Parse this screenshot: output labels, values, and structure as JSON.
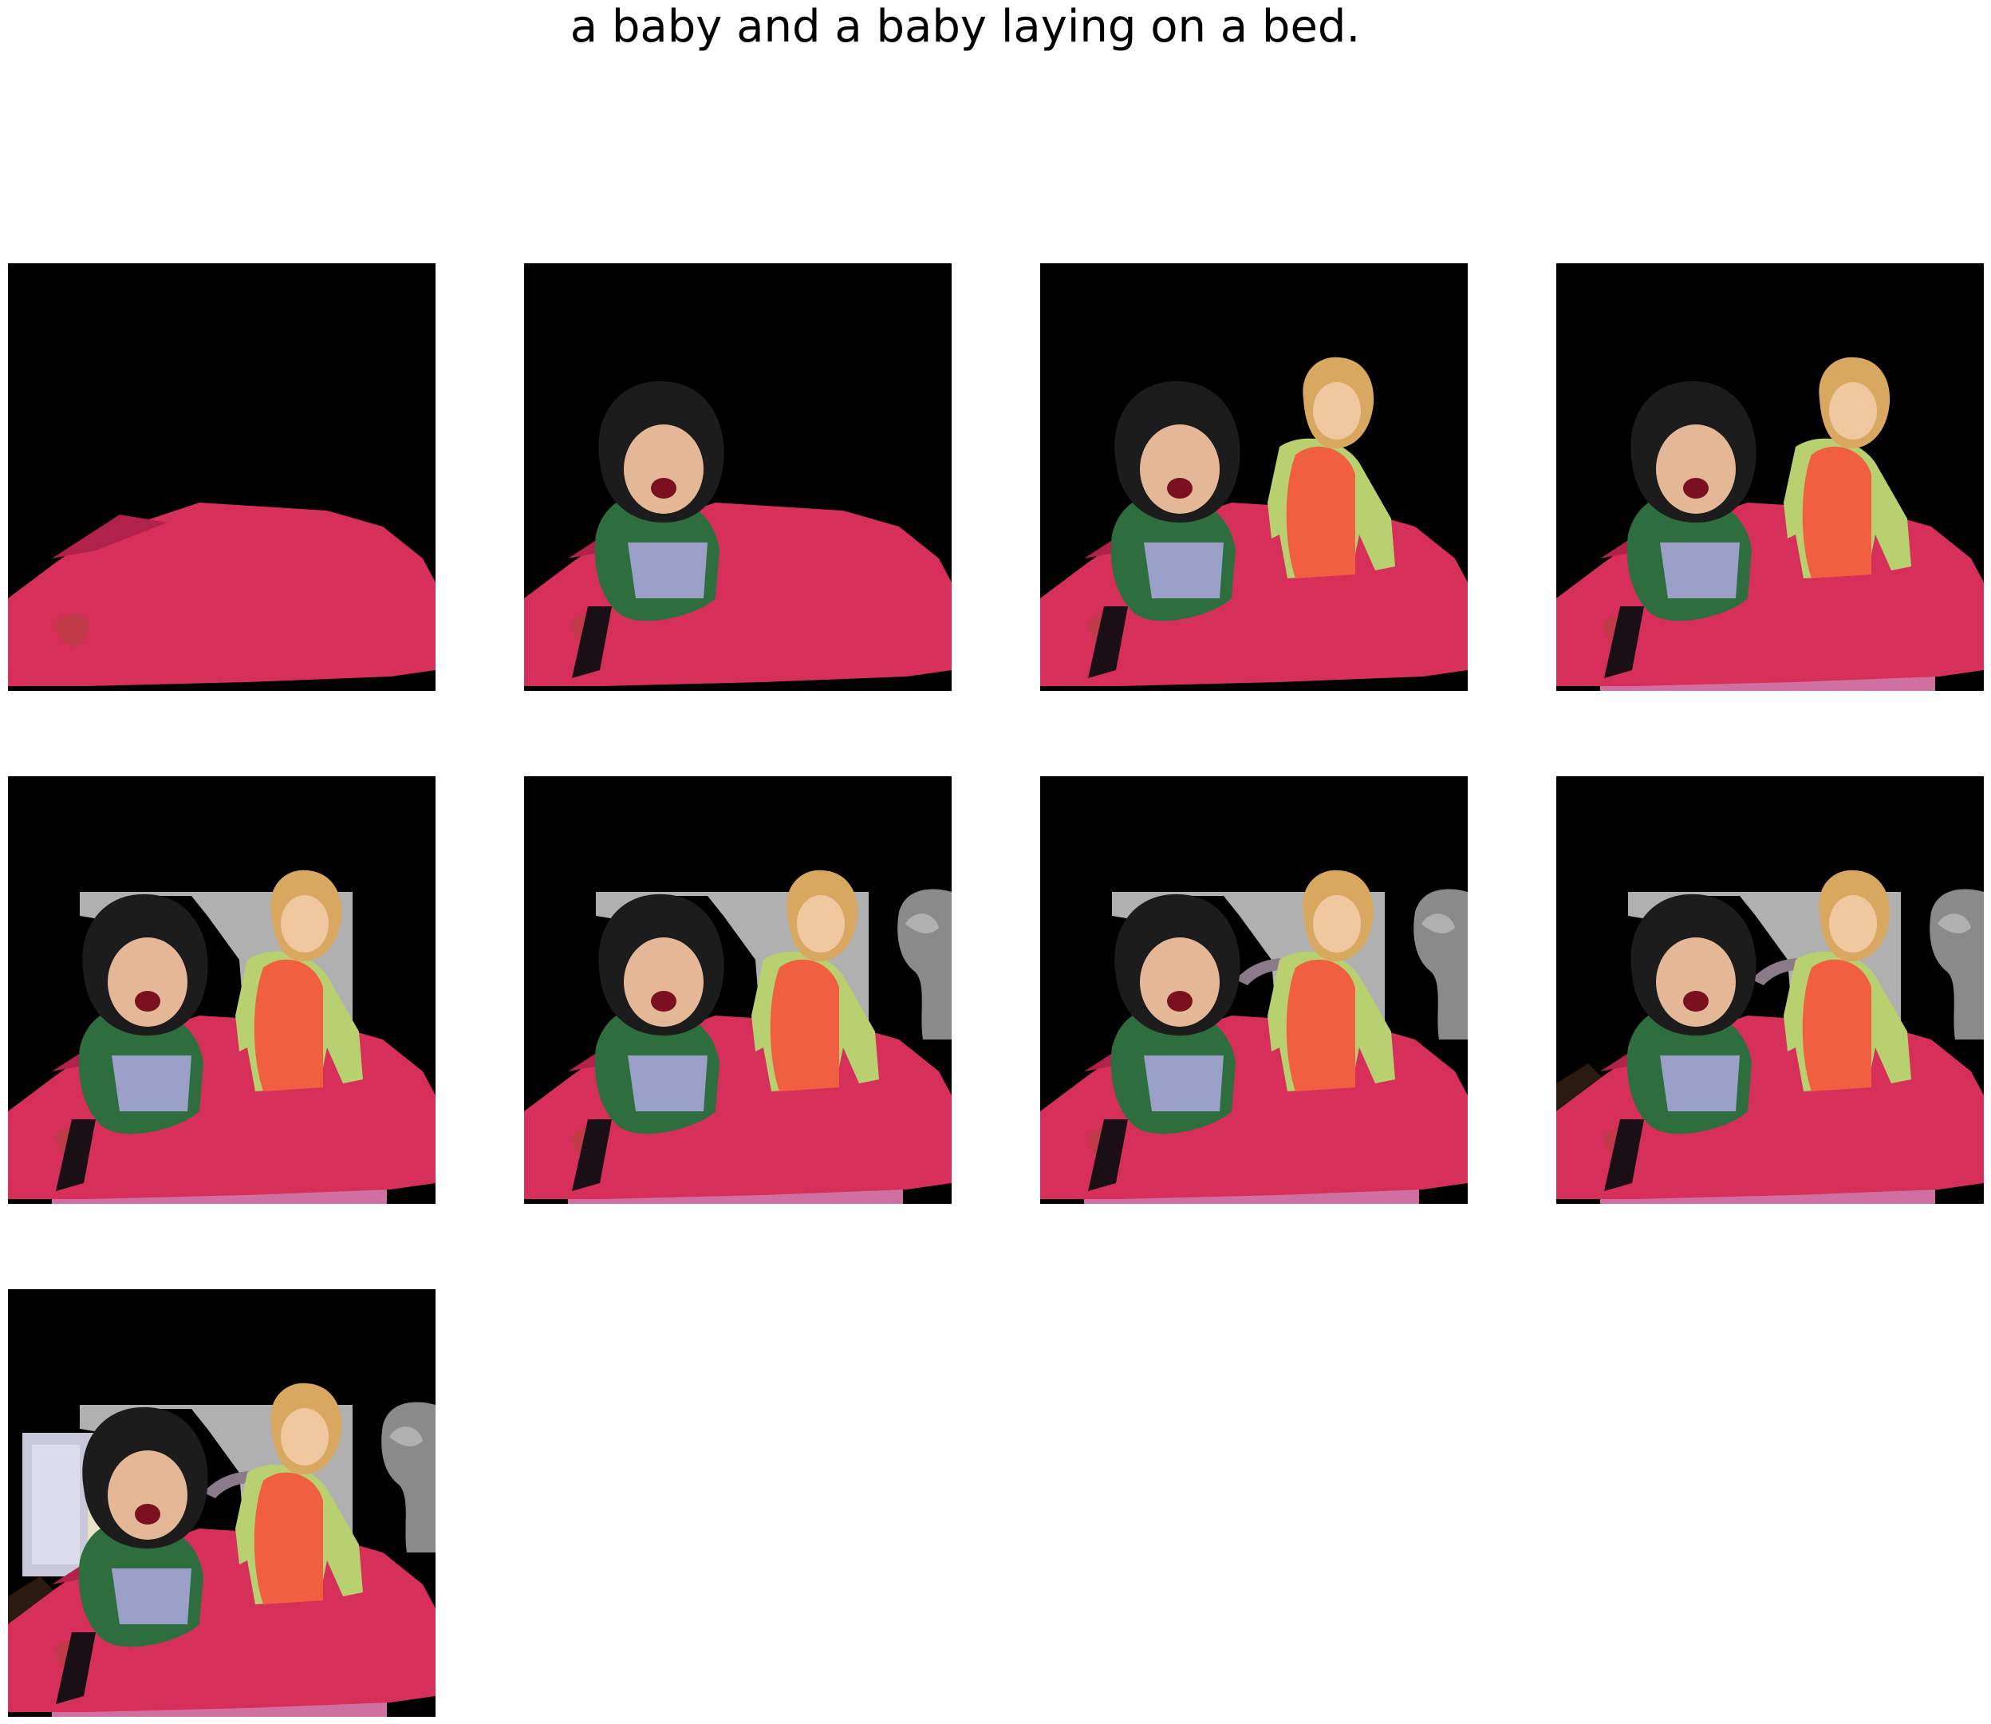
{
  "caption": "a baby and a baby laying on a bed.",
  "panels": [
    {
      "layers": [
        "bed"
      ]
    },
    {
      "layers": [
        "bed",
        "child-left"
      ]
    },
    {
      "layers": [
        "bed",
        "child-left",
        "child-right"
      ]
    },
    {
      "layers": [
        "bed",
        "child-left",
        "child-right",
        "pink-base"
      ]
    },
    {
      "layers": [
        "bed",
        "child-left",
        "child-right",
        "pink-base",
        "wall"
      ]
    },
    {
      "layers": [
        "bed",
        "child-left",
        "child-right",
        "pink-base",
        "wall",
        "plant"
      ]
    },
    {
      "layers": [
        "bed",
        "child-left",
        "child-right",
        "pink-base",
        "wall",
        "plant",
        "arm"
      ]
    },
    {
      "layers": [
        "bed",
        "child-left",
        "child-right",
        "pink-base",
        "wall",
        "plant",
        "arm",
        "shadow"
      ]
    },
    {
      "layers": [
        "bed",
        "child-left",
        "child-right",
        "pink-base",
        "wall",
        "plant",
        "arm",
        "shadow",
        "window"
      ]
    }
  ],
  "colors": {
    "background": "#000000",
    "bed": "#d6305a",
    "bed_dark": "#b0224a",
    "child_left_hair": "#1c1c1c",
    "child_left_face": "#e4b896",
    "child_left_shirt": "#2e6e3e",
    "child_right_hair": "#d9a860",
    "child_right_face": "#f0c8a0",
    "child_right_jacket": "#b8d070",
    "child_right_vest": "#f06040",
    "pink_base": "#d070a0",
    "wall": "#b0b0b0",
    "plant": "#8a8a8a",
    "window": "#c8c8d8"
  }
}
